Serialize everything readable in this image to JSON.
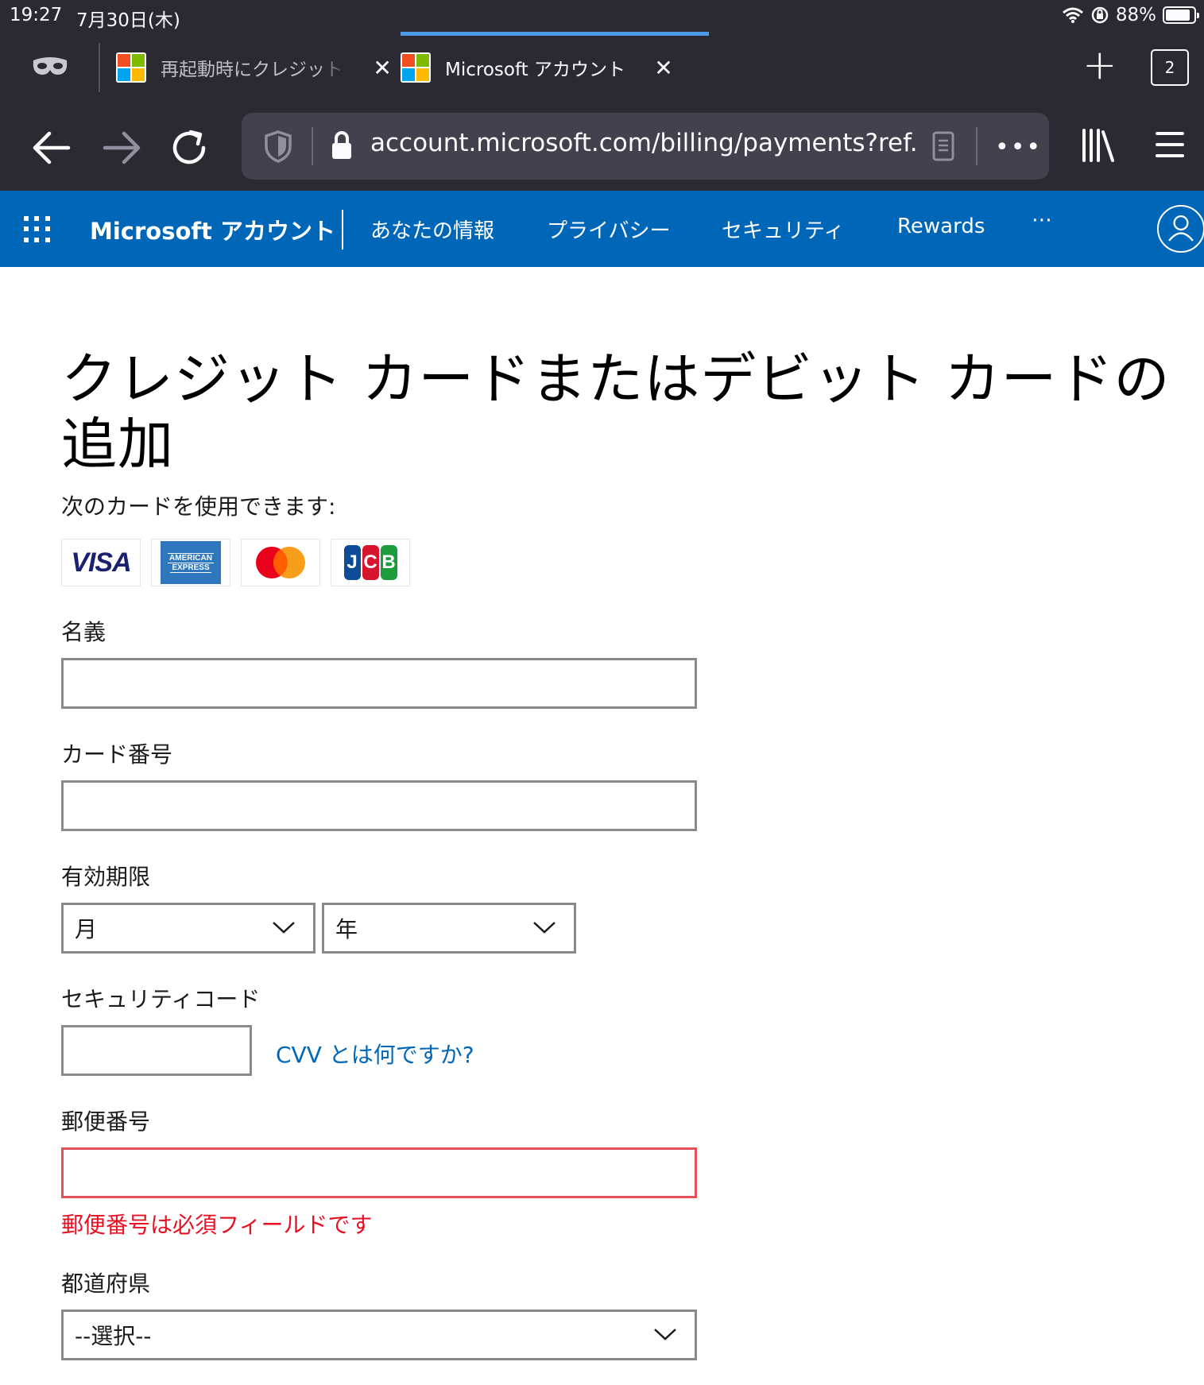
{
  "status_bar": {
    "time": "19:27",
    "date": "7月30日(木)",
    "battery": "88%",
    "battery_level": 0.88
  },
  "tabs": [
    {
      "title": "再起動時にクレジット",
      "active": false,
      "close": "✕"
    },
    {
      "title": "Microsoft アカウント",
      "active": true,
      "close": "✕"
    }
  ],
  "tab_count": "2",
  "url_bar": {
    "url": "account.microsoft.com/billing/payments?ref..."
  },
  "site_header": {
    "brand": "Microsoft アカウント",
    "nav": [
      "あなたの情報",
      "プライバシー",
      "セキュリティ",
      "Rewards"
    ],
    "more": "⋯"
  },
  "page": {
    "title": "クレジット カードまたはデビット カードの追加",
    "accept_label": "次のカードを使用できます:",
    "cards": {
      "visa": "VISA",
      "amex_line1": "AMERICAN",
      "amex_line2": "EXPRESS",
      "jcb": [
        "J",
        "C",
        "B"
      ]
    },
    "fields": {
      "name_label": "名義",
      "name_value": "",
      "card_number_label": "カード番号",
      "card_number_value": "",
      "expiry_label": "有効期限",
      "expiry_month": "月",
      "expiry_year": "年",
      "security_code_label": "セキュリティコード",
      "security_code_value": "",
      "cvv_link": "CVV とは何ですか?",
      "postal_code_label": "郵便番号",
      "postal_code_value": "",
      "postal_code_error": "郵便番号は必須フィールドです",
      "prefecture_label": "都道府県",
      "prefecture_value": "--選択--"
    }
  },
  "colors": {
    "chrome_bg": "#2b2a33",
    "urlbar_bg": "#42414d",
    "header_blue": "#0067b8",
    "link_blue": "#0067b8",
    "error_red": "#e81123",
    "error_border": "#e5505a"
  }
}
